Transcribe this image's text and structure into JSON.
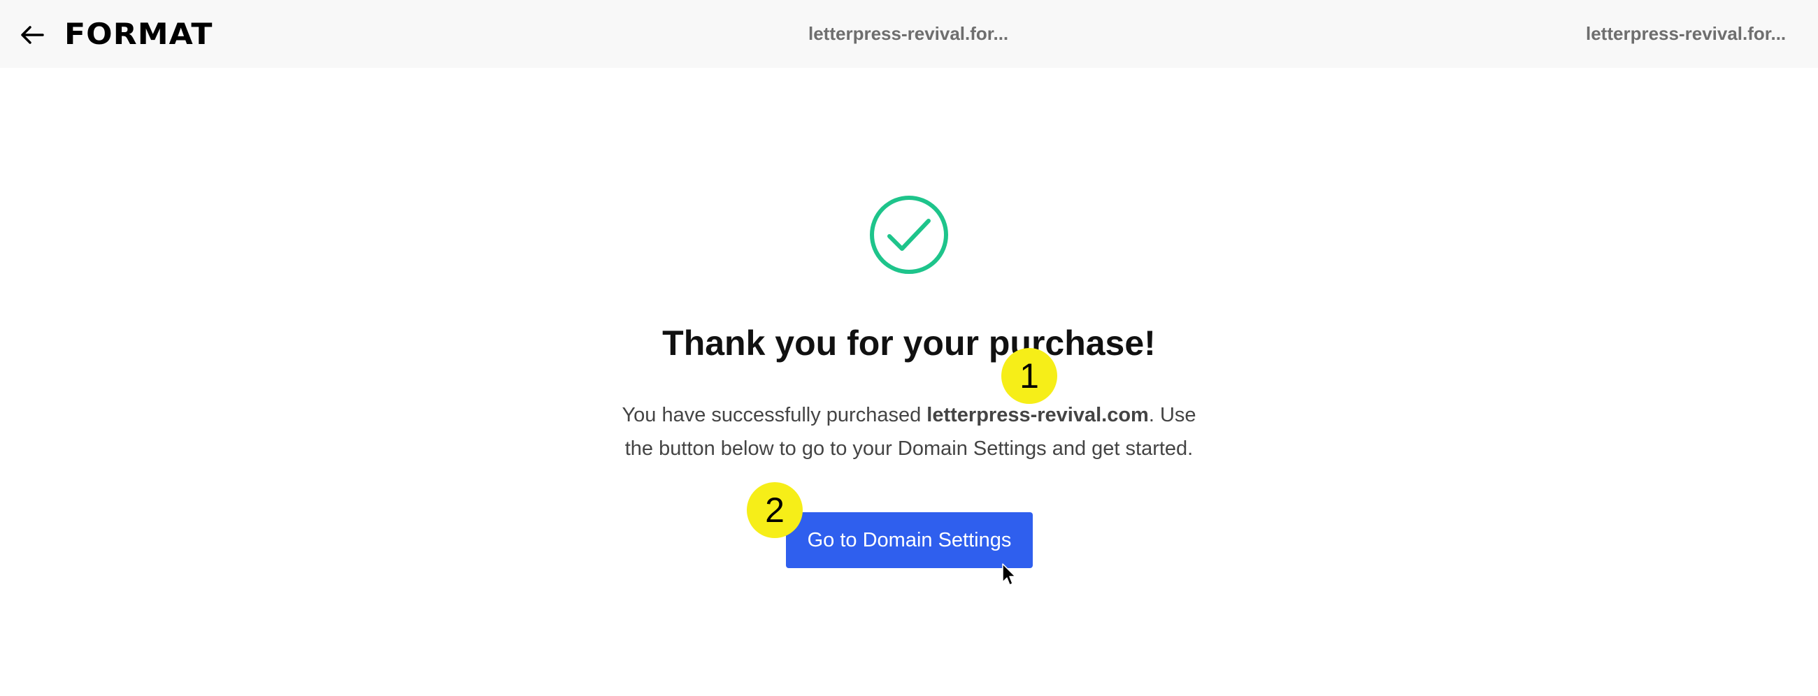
{
  "topbar": {
    "back_icon": "arrow-left-icon",
    "logo": "FORMAT",
    "domain_center": "letterpress-revival.for...",
    "domain_right": "letterpress-revival.for..."
  },
  "confirmation": {
    "icon": "check-circle-icon",
    "icon_color": "#1ec48b",
    "title": "Thank you for your purchase!",
    "message_before": "You have successfully purchased ",
    "domain": "letterpress-revival.com",
    "message_after": ". Use the button below to go to your Domain Settings and get started.",
    "button_label": "Go to Domain Settings",
    "button_color": "#2f5fee"
  },
  "annotations": {
    "marker_1": "1",
    "marker_2": "2",
    "marker_color": "#f6ee18"
  }
}
